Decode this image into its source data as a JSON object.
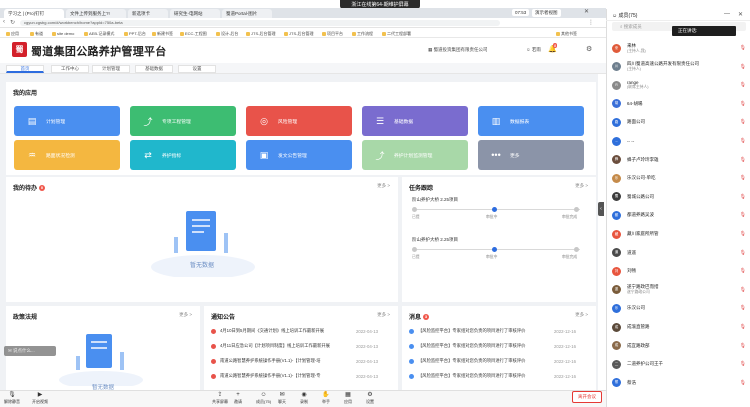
{
  "meeting": {
    "banner": "浙江在线第64-期维护屏幕"
  },
  "browser": {
    "tabs": [
      "学习之 | (Pro)钉钉",
      "文件上传到服务上?!",
      "新选项卡",
      "研究生-电网站",
      "蜀道Portal-图片"
    ],
    "url": "cgyun.cgsbg.com/#/workbench/home?appId=750a-beta",
    "time": "07:53",
    "mode_btn": "演示者视图",
    "bookmarks": [
      "应用",
      "有道",
      "site demo",
      "AEB-记录模式",
      "PPT-后台",
      "新建书签",
      "ECC-工程图",
      "设计-后台",
      "JTS-后台管理",
      "JTS-后台管理",
      "项目平台",
      "工作流程",
      "二代工程部署",
      "其他书签"
    ]
  },
  "app": {
    "logo_text": "蜀",
    "title": "蜀道集团公路养护管理平台",
    "company": "蜀道投资集团有限责任公司",
    "user": "若雨",
    "notice_count": "8",
    "nav_tabs": [
      "首页",
      "工作中心",
      "计划管理",
      "基础数据",
      "设置"
    ]
  },
  "my_apps": {
    "title": "我的应用",
    "tiles": [
      {
        "label": "计划管理",
        "color": "#4a8ff0",
        "icon": "folder-icon",
        "glyph": "▤"
      },
      {
        "label": "专项工程管理",
        "color": "#3dbd72",
        "icon": "trend-chart-icon",
        "glyph": "⤴"
      },
      {
        "label": "风险管理",
        "color": "#e8534a",
        "icon": "risk-target-icon",
        "glyph": "◎"
      },
      {
        "label": "基础数据",
        "color": "#7a6ccf",
        "icon": "layers-icon",
        "glyph": "☰"
      },
      {
        "label": "数据报表",
        "color": "#4a8ff0",
        "icon": "report-icon",
        "glyph": "▥"
      },
      {
        "label": "路面状况检测",
        "color": "#f4b740",
        "icon": "pulse-icon",
        "glyph": "♒"
      },
      {
        "label": "养护指标",
        "color": "#20b7cc",
        "icon": "transfer-icon",
        "glyph": "⇄"
      },
      {
        "label": "发文公告管理",
        "color": "#4a8ff0",
        "icon": "document-icon",
        "glyph": "▣"
      },
      {
        "label": "养护计划监测管理",
        "color": "#a8d8a8",
        "icon": "line-chart-icon",
        "glyph": "⤴"
      },
      {
        "label": "更多",
        "color": "#8b94a8",
        "icon": "more-dots-icon",
        "glyph": "•••"
      }
    ]
  },
  "todo": {
    "title": "我的待办",
    "count": "0",
    "more": "更多 >",
    "empty_text": "暂无数据"
  },
  "progress": {
    "title": "任务跟踪",
    "more": "更多 >",
    "rows": [
      {
        "name": "阶山养护大桥 2.25项目",
        "labels": [
          "已提",
          "审批中",
          "审批完成"
        ],
        "step": 1
      },
      {
        "name": "阶山养护大桥 2.25项目",
        "labels": [
          "已提",
          "审批中",
          "审批完成"
        ],
        "step": 1
      }
    ]
  },
  "policy": {
    "title": "政策法规",
    "more": "更多 >",
    "empty_text": "暂无数据"
  },
  "notice": {
    "title": "通知公告",
    "more": "更多 >",
    "items": [
      {
        "text": "4月10日到5月期间《交通计划》线上培训工作最新开展",
        "date": "2022-04-13"
      },
      {
        "text": "4月11日应急公司【计划项目制度】线上培训工作最新开展",
        "date": "2022-04-13"
      },
      {
        "text": "南道公路智慧养护系统操作手册(V1.1)-【计划管理-培",
        "date": "2022-04-13"
      },
      {
        "text": "南道公路智慧养护系统操作手册(V1.1)-【计划管理-专",
        "date": "2022-04-13"
      }
    ]
  },
  "messages": {
    "title": "消息",
    "count": "3",
    "more": "更多 >",
    "items": [
      {
        "text": "【风险监控平台】专家组对您负责的项目进行了审核评价",
        "date": "2022-12-16"
      },
      {
        "text": "【风险监控平台】专家组对您负责的项目进行了审核评价",
        "date": "2022-12-16"
      },
      {
        "text": "【风险监控平台】专家组对您负责的项目进行了审核评价",
        "date": "2022-12-16"
      },
      {
        "text": "【风险监控平台】专家组对您负责的项目进行了审核评价",
        "date": "2022-12-16"
      }
    ]
  },
  "chat_input": {
    "placeholder": "说点什么..."
  },
  "toolbar": {
    "left": [
      {
        "label": "解除静音",
        "icon": "mic-off-icon",
        "glyph": "🎙"
      },
      {
        "label": "开启视频",
        "icon": "camera-off-icon",
        "glyph": "▶"
      }
    ],
    "center": [
      {
        "label": "共享屏幕",
        "icon": "share-screen-icon",
        "glyph": "⇪"
      },
      {
        "label": "邀请",
        "icon": "invite-icon",
        "glyph": "+"
      },
      {
        "label": "成员(75)",
        "icon": "members-icon",
        "glyph": "☺"
      },
      {
        "label": "聊天",
        "icon": "chat-icon",
        "glyph": "✉"
      },
      {
        "label": "录制",
        "icon": "record-icon",
        "glyph": "◉"
      },
      {
        "label": "举手",
        "icon": "hand-icon",
        "glyph": "✋"
      },
      {
        "label": "应用",
        "icon": "apps-icon",
        "glyph": "▦"
      },
      {
        "label": "设置",
        "icon": "settings-icon",
        "glyph": "⚙"
      }
    ],
    "end_label": "离开会议"
  },
  "panel": {
    "title": "成员(75)",
    "search_placeholder": "搜索成员",
    "speaking": "正在讲话:",
    "members": [
      {
        "name": "来林",
        "sub": "(主持人,我)",
        "color": "#e05b3a",
        "init": "来"
      },
      {
        "name": "四川蜀道高速公路开发有限责任公司",
        "sub": "(主持人)",
        "color": "#6e7f8e",
        "init": "川"
      },
      {
        "name": "range",
        "sub": "(联席主持人)",
        "color": "#8a8a8a",
        "init": "R"
      },
      {
        "name": "64-胡暘",
        "sub": "",
        "color": "#3a6fd8",
        "init": "胡"
      },
      {
        "name": "路面公司",
        "sub": "",
        "color": "#2f6fdb",
        "init": "路"
      },
      {
        "name": "-- --",
        "sub": "",
        "color": "#2f6fdb",
        "init": "--"
      },
      {
        "name": "蜂子卢玲玲李雄",
        "sub": "",
        "color": "#6b4e3d",
        "init": "蜂"
      },
      {
        "name": "乐汉公司-单吃",
        "sub": "",
        "color": "#c58b4a",
        "init": "乐"
      },
      {
        "name": "蜀城公路公司",
        "sub": "",
        "color": "#3d3d3d",
        "init": "蜀"
      },
      {
        "name": "都道养路吴波",
        "sub": "",
        "color": "#2f6fdb",
        "init": "都"
      },
      {
        "name": "藏川家庭所所管",
        "sub": "",
        "color": "#e8553e",
        "init": "藏"
      },
      {
        "name": "道遥",
        "sub": "",
        "color": "#4a4a4a",
        "init": "道"
      },
      {
        "name": "刘畅",
        "sub": "",
        "color": "#e8553e",
        "init": "刘"
      },
      {
        "name": "遂宁路政巴而措",
        "sub": "遂宁路政公司",
        "color": "#7a5c3a",
        "init": "遂"
      },
      {
        "name": "乐汉公司",
        "sub": "",
        "color": "#2f6fdb",
        "init": "乐"
      },
      {
        "name": "成渝直管路",
        "sub": "",
        "color": "#5b4a3a",
        "init": "成"
      },
      {
        "name": "成宜路政部",
        "sub": "",
        "color": "#8a6a4a",
        "init": "成"
      },
      {
        "name": "二道养护公司王千",
        "sub": "",
        "color": "#5a5a5a",
        "init": "二"
      },
      {
        "name": "蔡浩",
        "sub": "",
        "color": "#2f6fdb",
        "init": "蔡"
      }
    ]
  }
}
